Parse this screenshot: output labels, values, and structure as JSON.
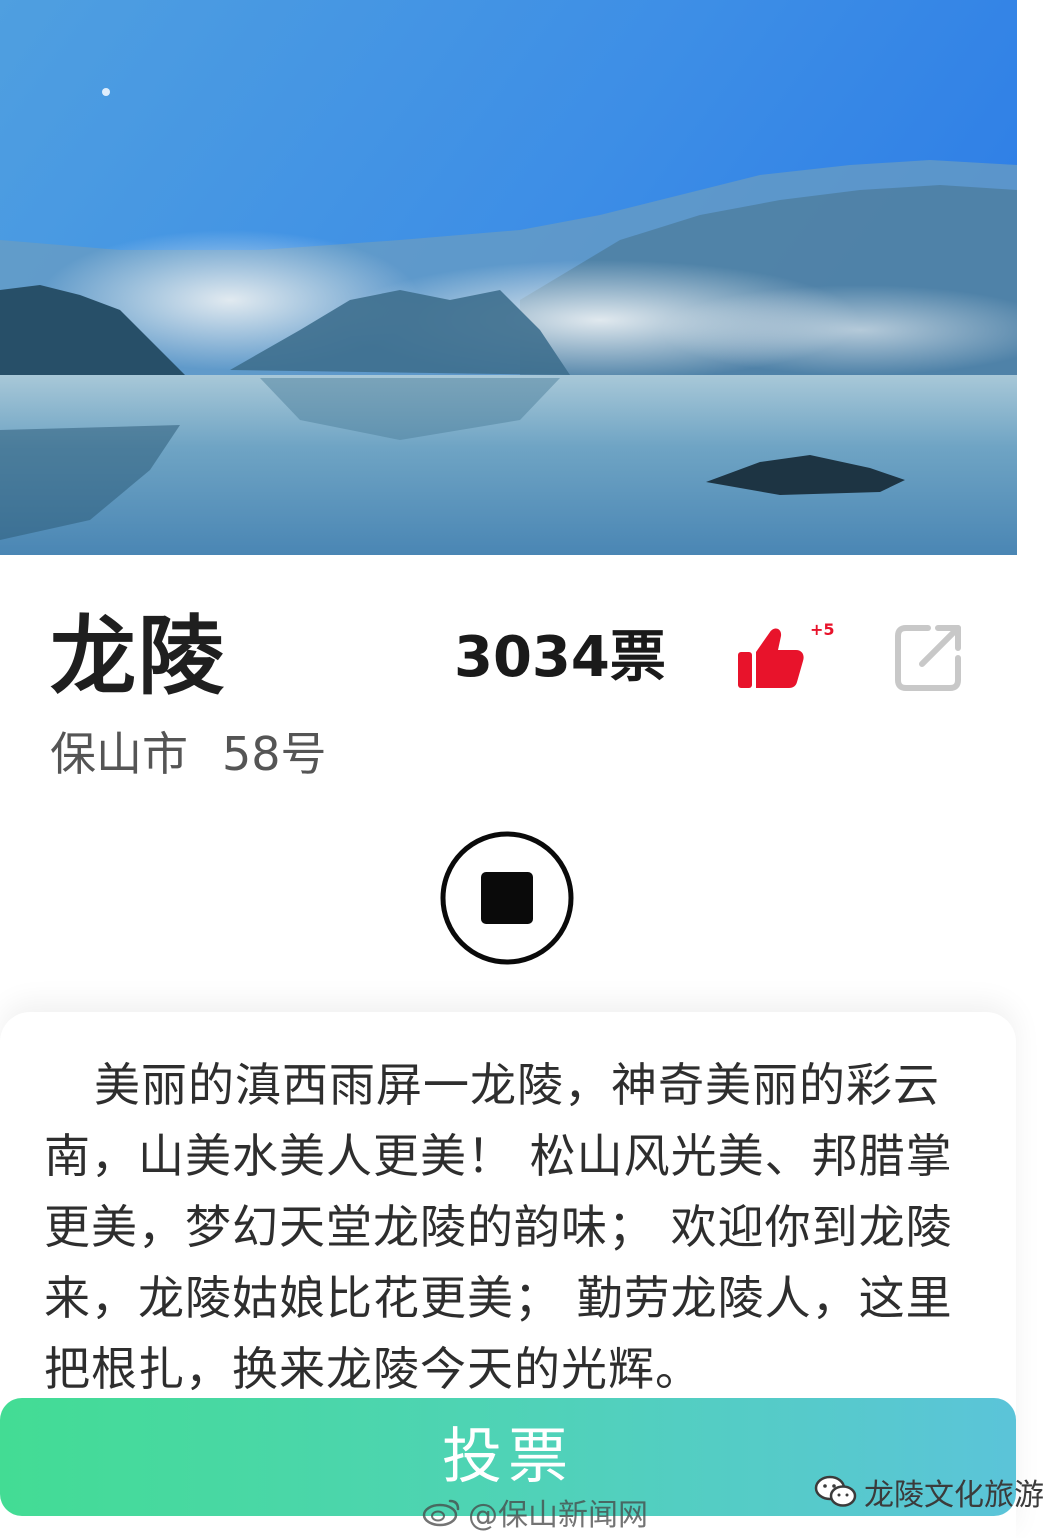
{
  "attraction": {
    "name": "龙陵",
    "votes_label": "3034票",
    "like_increment": "+5",
    "city": "保山市",
    "number": "58号"
  },
  "description": "美丽的滇西雨屏一龙陵，神奇美丽的彩云南，山美水美人更美！ 松山风光美、邦腊掌更美，梦幻天堂龙陵的韵味； 欢迎你到龙陵来，龙陵姑娘比花更美； 勤劳龙陵人，这里把根扎，换来龙陵今天的光辉。",
  "vote_button_label": "投票",
  "watermarks": {
    "weibo": "@保山新闻网",
    "wechat": "龙陵文化旅游"
  },
  "colors": {
    "like": "#e8132b",
    "vote_gradient_start": "#43dc94",
    "vote_gradient_end": "#5bc4d9"
  },
  "icons": {
    "like": "thumbs-up-icon",
    "share": "share-external-icon",
    "stop": "stop-icon"
  }
}
